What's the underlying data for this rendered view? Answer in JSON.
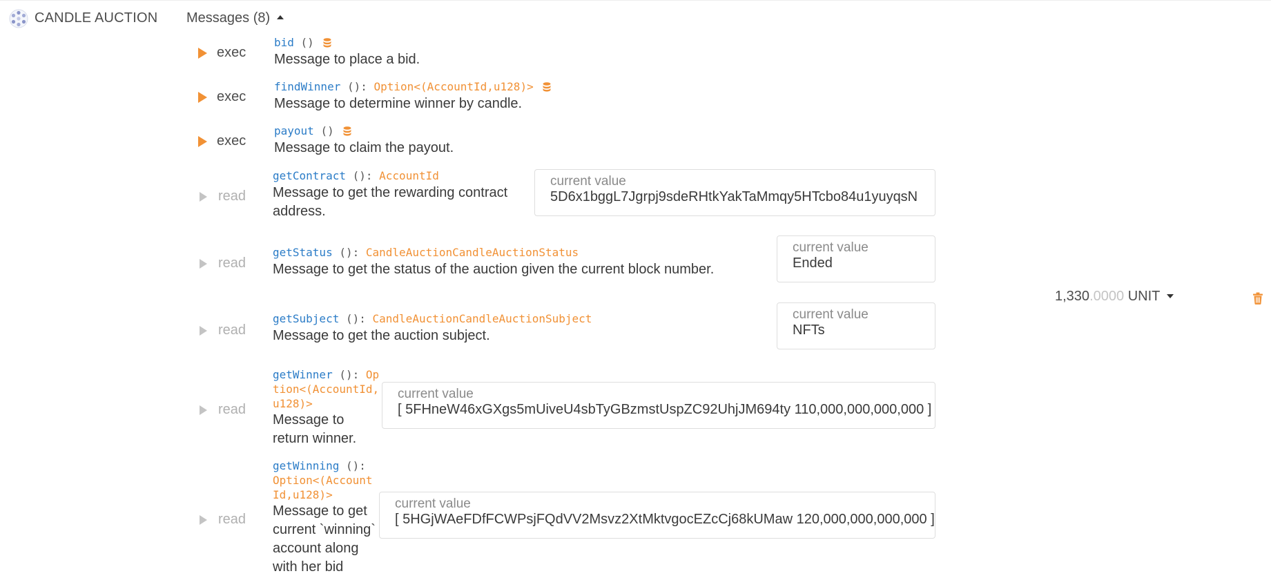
{
  "contract": {
    "name": "CANDLE AUCTION",
    "icon": "contract-identicon-icon"
  },
  "messages_header": {
    "label": "Messages (8)"
  },
  "messages": [
    {
      "kind": "exec",
      "run_label": "exec",
      "name": "bid",
      "params": "()",
      "returns": "",
      "description": "Message to place a bid."
    },
    {
      "kind": "exec",
      "run_label": "exec",
      "name": "findWinner",
      "params": "():",
      "returns": "Option<(AccountId,u128)>",
      "description": "Message to determine winner by candle."
    },
    {
      "kind": "exec",
      "run_label": "exec",
      "name": "payout",
      "params": "()",
      "returns": "",
      "description": "Message to claim the payout."
    },
    {
      "kind": "read",
      "run_label": "read",
      "name": "getContract",
      "params": "():",
      "returns": "AccountId",
      "description": "Message to get the rewarding contract address.",
      "value_label": "current value",
      "value": "5D6x1bggL7Jgrpj9sdeRHtkYakTaMmqy5HTcbo84u1yuyqsN"
    },
    {
      "kind": "read",
      "run_label": "read",
      "name": "getStatus",
      "params": "():",
      "returns": "CandleAuctionCandleAuctionStatus",
      "description": "Message to get the status of the auction given the current block number.",
      "value_label": "current value",
      "value": "Ended"
    },
    {
      "kind": "read",
      "run_label": "read",
      "name": "getSubject",
      "params": "():",
      "returns": "CandleAuctionCandleAuctionSubject",
      "description": "Message to get the auction subject.",
      "value_label": "current value",
      "value": "NFTs"
    },
    {
      "kind": "read",
      "run_label": "read",
      "name": "getWinner",
      "params": "():",
      "returns": "Option<(AccountId,u128)>",
      "description": "Message to return winner.",
      "value_label": "current value",
      "value": "[ 5FHneW46xGXgs5mUiveU4sbTyGBzmstUspZC92UhjJM694ty 110,000,000,000,000 ]"
    },
    {
      "kind": "read",
      "run_label": "read",
      "name": "getWinning",
      "params": "():",
      "returns": "Option<(AccountId,u128)>",
      "description": "Message to get current `winning` account along with her bid",
      "value_label": "current value",
      "value": "[ 5HGjWAeFDfFCWPsjFQdVV2Msvz2XtMktvgocEZcCj68kUMaw 120,000,000,000,000 ]"
    }
  ],
  "balance": {
    "integer": "1,330",
    "decimals": ".0000",
    "unit": "UNIT"
  },
  "colors": {
    "accent": "#f19135",
    "function_name": "#2b7cc7",
    "muted": "#c4c4c4"
  }
}
